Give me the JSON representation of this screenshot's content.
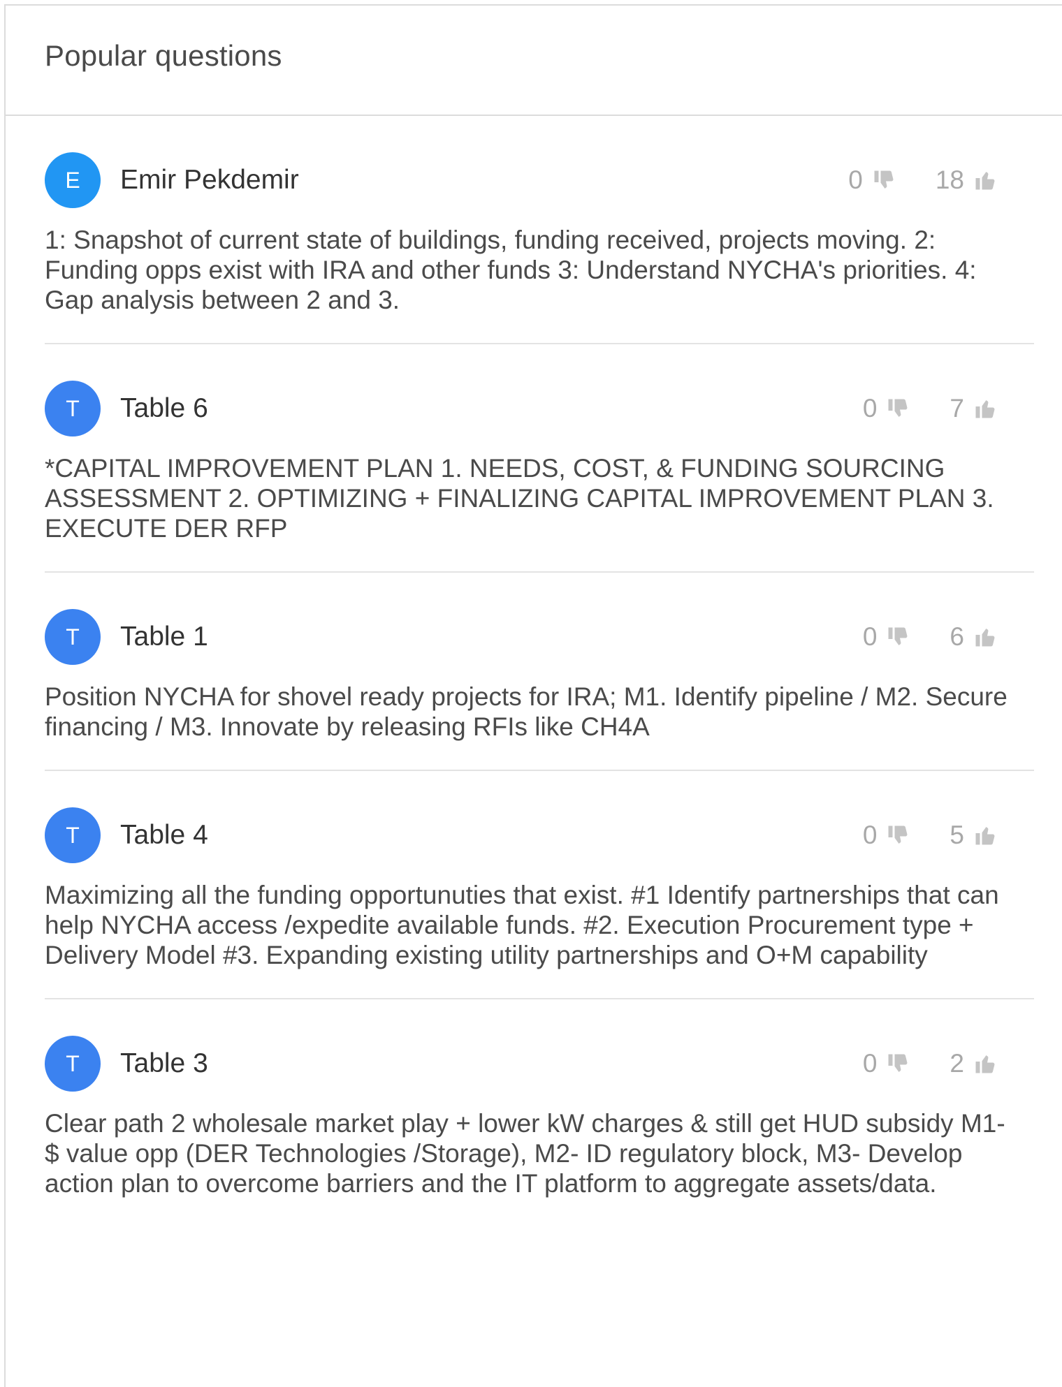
{
  "panel": {
    "title": "Popular questions"
  },
  "questions": [
    {
      "avatar_letter": "E",
      "author": "Emir Pekdemir",
      "downvotes": "0",
      "upvotes": "18",
      "text": "1: Snapshot of current state of buildings, funding received, projects moving. 2: Funding opps exist with IRA and other funds 3: Understand NYCHA's priorities. 4: Gap analysis between 2 and 3."
    },
    {
      "avatar_letter": "T",
      "author": "Table 6",
      "downvotes": "0",
      "upvotes": "7",
      "text": "*CAPITAL IMPROVEMENT PLAN 1. NEEDS, COST, & FUNDING SOURCING ASSESSMENT 2. OPTIMIZING + FINALIZING CAPITAL IMPROVEMENT PLAN 3. EXECUTE DER RFP"
    },
    {
      "avatar_letter": "T",
      "author": "Table 1",
      "downvotes": "0",
      "upvotes": "6",
      "text": "Position NYCHA for shovel ready projects for IRA; M1. Identify pipeline / M2. Secure financing / M3. Innovate by releasing RFIs like CH4A"
    },
    {
      "avatar_letter": "T",
      "author": "Table 4",
      "downvotes": "0",
      "upvotes": "5",
      "text": "Maximizing all the funding opportunuties that exist. #1 Identify partnerships that can help NYCHA access /expedite available funds. #2. Execution Procurement type + Delivery Model #3. Expanding existing utility partnerships and O+M capability"
    },
    {
      "avatar_letter": "T",
      "author": "Table 3",
      "downvotes": "0",
      "upvotes": "2",
      "text": "Clear path 2 wholesale market play + lower kW charges & still get HUD subsidy M1- $ value opp (DER Technologies /Storage), M2- ID regulatory block, M3- Develop action plan to overcome barriers and the IT platform to aggregate assets/data."
    }
  ],
  "colors": {
    "avatar_e": "#2196f3",
    "avatar_t": "#3b82f0",
    "vote_gray": "#a8a8a8",
    "divider": "#e3e3e3"
  },
  "icons": {
    "downvote": "thumbs-down-icon",
    "upvote": "thumbs-up-icon"
  }
}
